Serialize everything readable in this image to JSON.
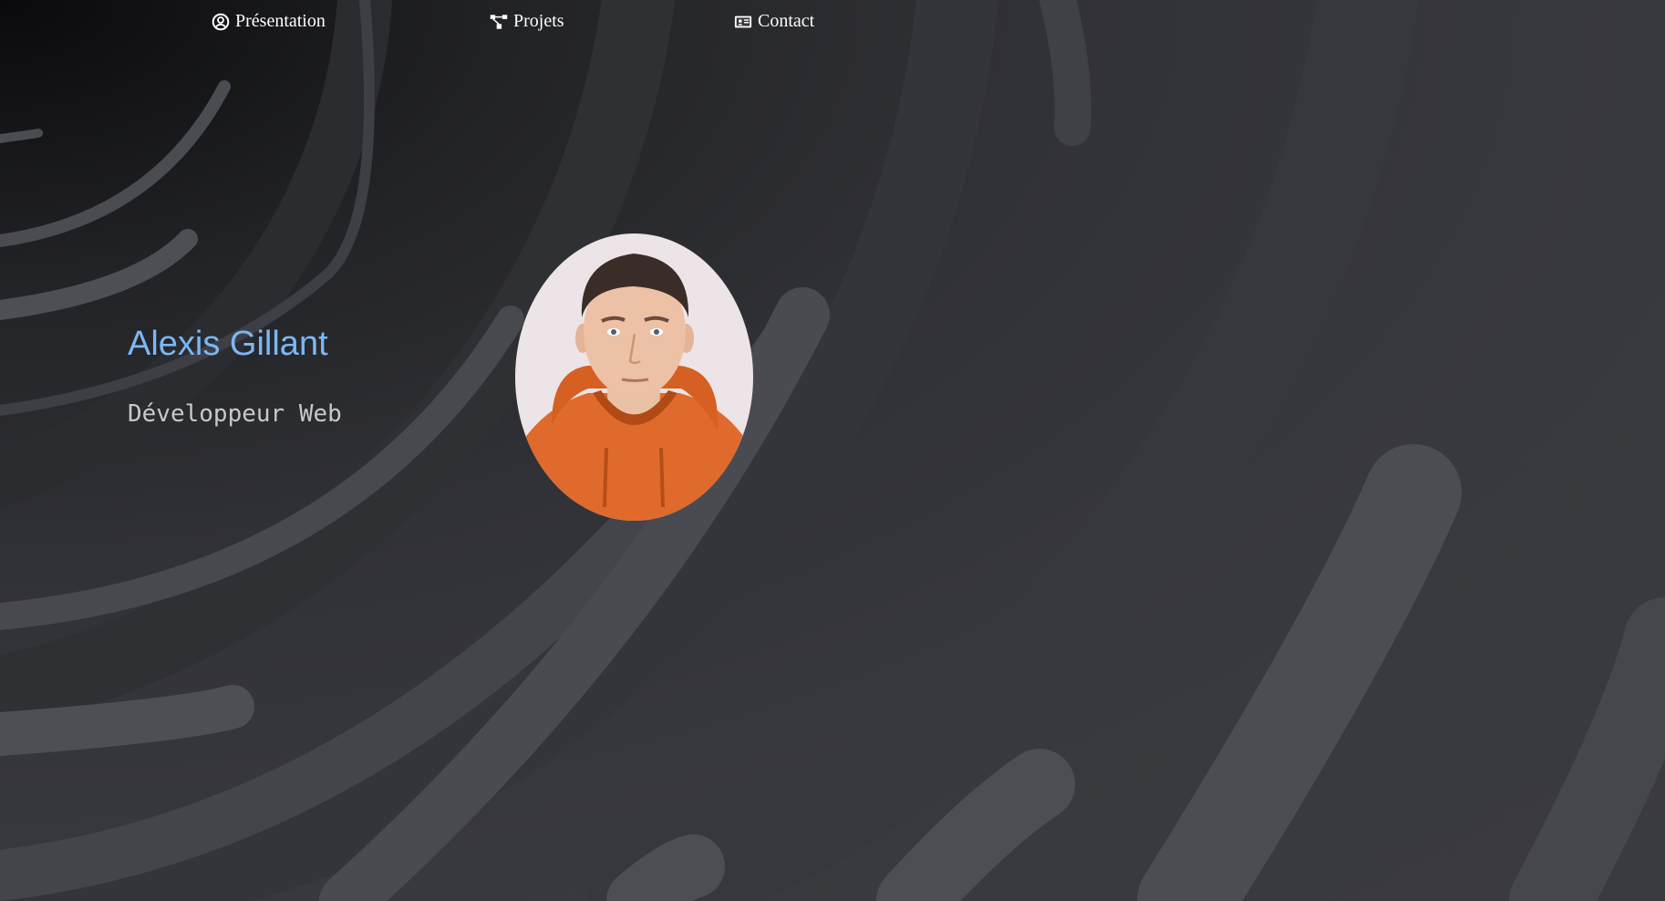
{
  "nav": {
    "items": [
      {
        "label": "Présentation",
        "icon": "user-circle-icon"
      },
      {
        "label": "Projets",
        "icon": "sitemap-icon"
      },
      {
        "label": "Contact",
        "icon": "id-card-icon"
      }
    ]
  },
  "hero": {
    "name": "Alexis Gillant",
    "role": "Développeur Web"
  },
  "colors": {
    "background": "#35363b",
    "name_accent": "#7ab8f5",
    "role_text": "#c9c9c9",
    "nav_text": "#ffffff",
    "swirl": "#4e4f55"
  }
}
